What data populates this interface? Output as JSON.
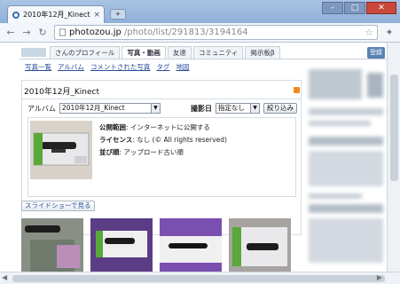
{
  "browser": {
    "tab_title": "2010年12月_Kinect - ...",
    "tab_close": "×",
    "new_tab": "+",
    "url_host": "photozou.jp",
    "url_path": "/photo/list/291813/3194164",
    "nav_back": "←",
    "nav_forward": "→",
    "nav_reload": "↻",
    "bookmark_star": "☆",
    "wrench": "✦",
    "win_min": "–",
    "win_max": "□",
    "win_close": "✕"
  },
  "site_nav": {
    "items": [
      {
        "label": "さんのプロフィール",
        "active": false
      },
      {
        "label": "写真・動画",
        "active": true
      },
      {
        "label": "友達",
        "active": false
      },
      {
        "label": "コミュニティ",
        "active": false
      },
      {
        "label": "掲示板β",
        "active": false
      }
    ],
    "login_label": "登録"
  },
  "sub_nav": [
    "写真一覧",
    "アルバム",
    "コメントされた写真",
    "タグ",
    "地図"
  ],
  "panel": {
    "title": "2010年12月_Kinect",
    "album_label": "アルバム",
    "album_value": "2010年12月_Kinect",
    "date_label": "撮影日",
    "date_value": "指定なし",
    "filter_button": "絞り込み"
  },
  "info": {
    "visibility_key": "公開範囲",
    "visibility_value": "インターネットに公開する",
    "license_key": "ライセンス",
    "license_value": "なし (© All rights reserved)",
    "sort_key": "並び順",
    "sort_value": "アップロード古い順"
  },
  "slideshow_button": "スライドショーで見る",
  "colors": {
    "link": "#2a4f99",
    "active_tab_bg": "#ffffff",
    "login_bg": "#5a82b3",
    "rss": "#f28a22"
  }
}
